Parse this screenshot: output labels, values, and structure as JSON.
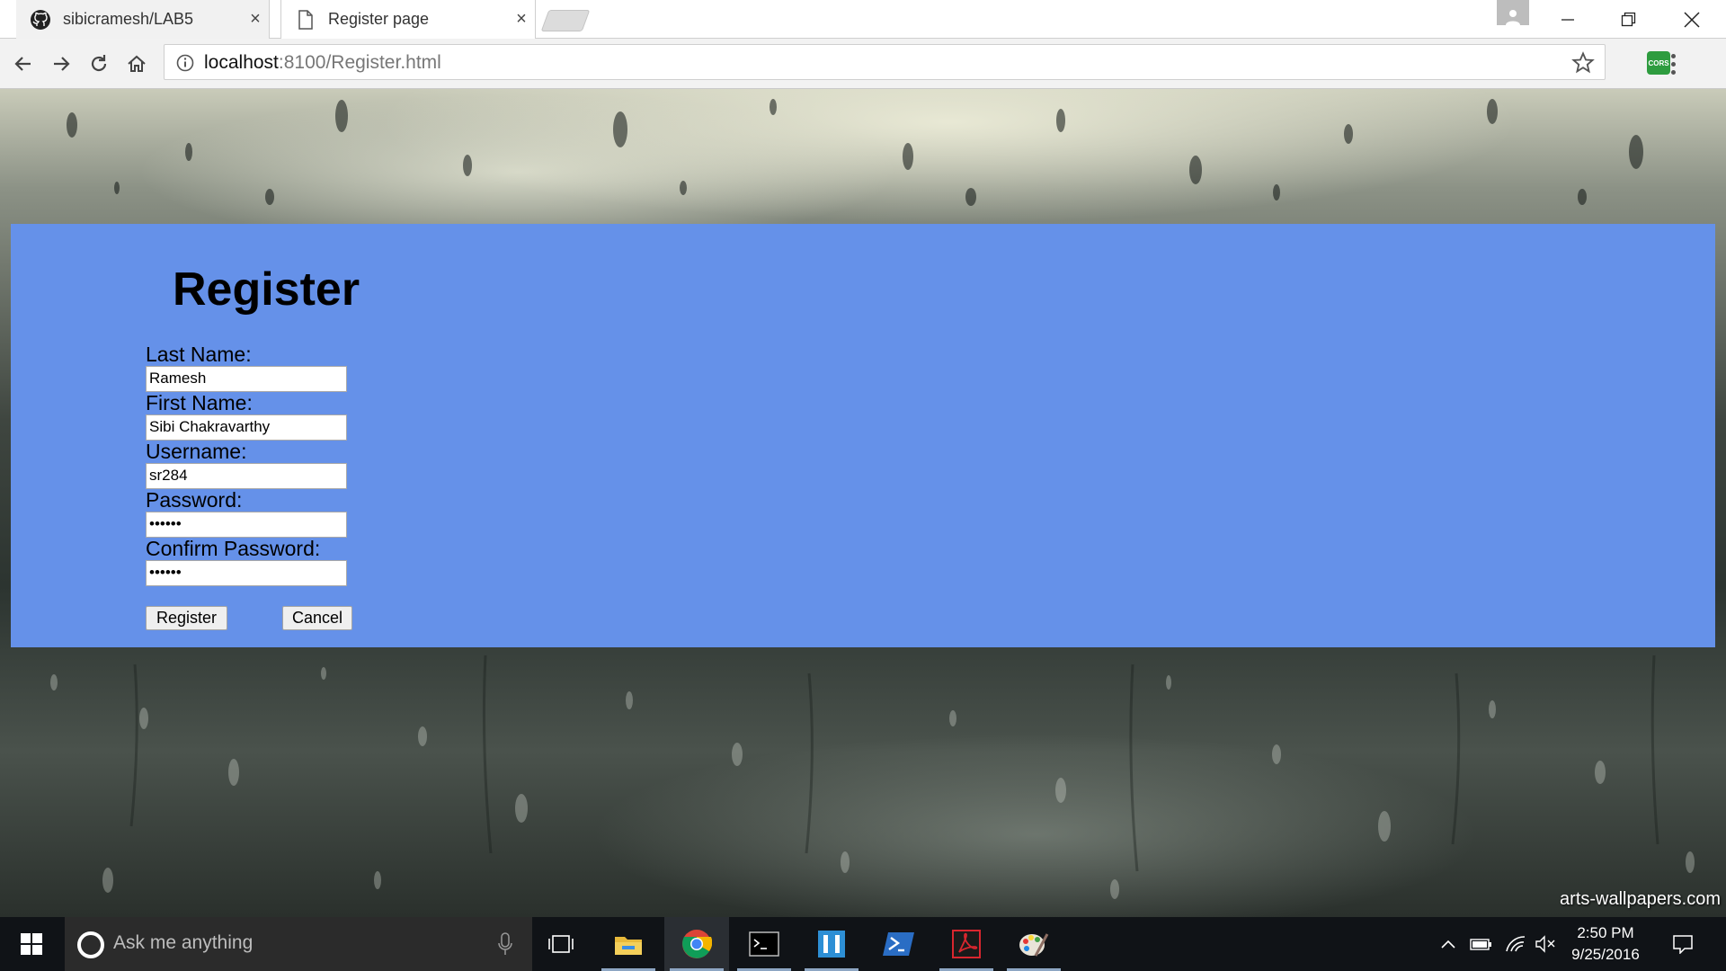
{
  "browser": {
    "tabs": [
      {
        "label": "sibicramesh/LAB5",
        "close": "×"
      },
      {
        "label": "Register page",
        "close": "×"
      }
    ],
    "address": {
      "host": "localhost",
      "path": ":8100/Register.html"
    },
    "extension_badge": "CORS"
  },
  "page": {
    "title": "Register",
    "fields": [
      {
        "label": "Last Name:",
        "value": "Ramesh"
      },
      {
        "label": "First Name:",
        "value": "Sibi Chakravarthy"
      },
      {
        "label": "Username:",
        "value": "sr284"
      },
      {
        "label": "Password:",
        "value": "••••••"
      },
      {
        "label": "Confirm Password:",
        "value": "••••••"
      }
    ],
    "register_button": "Register",
    "cancel_button": "Cancel",
    "panel_color": "#6591e9",
    "watermark": "arts-wallpapers.com"
  },
  "taskbar": {
    "search_placeholder": "Ask me anything",
    "time": "2:50 PM",
    "date": "9/25/2016",
    "apps": [
      "task-view-icon",
      "file-explorer-icon",
      "chrome-icon",
      "command-prompt-icon",
      "visual-studio-code-icon",
      "powershell-icon",
      "acrobat-reader-icon",
      "paint-icon"
    ]
  }
}
